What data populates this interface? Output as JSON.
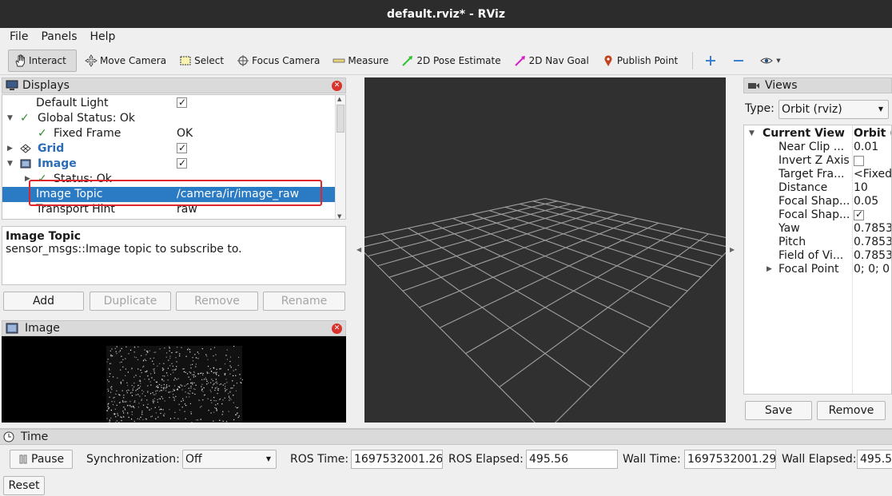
{
  "window": {
    "title": "default.rviz* - RViz"
  },
  "menu": [
    "File",
    "Panels",
    "Help"
  ],
  "toolbar": {
    "tools": [
      {
        "label": "Interact",
        "icon": "hand-icon",
        "active": true
      },
      {
        "label": "Move Camera",
        "icon": "move-camera-icon"
      },
      {
        "label": "Select",
        "icon": "select-icon"
      },
      {
        "label": "Focus Camera",
        "icon": "focus-camera-icon"
      },
      {
        "label": "Measure",
        "icon": "ruler-icon"
      },
      {
        "label": "2D Pose Estimate",
        "icon": "green-arrow-icon"
      },
      {
        "label": "2D Nav Goal",
        "icon": "pink-arrow-icon"
      },
      {
        "label": "Publish Point",
        "icon": "map-pin-icon"
      }
    ],
    "extra_icons": [
      "plus-icon",
      "minus-icon",
      "eye-icon"
    ]
  },
  "displays": {
    "title": "Displays",
    "rows": [
      {
        "name": "Default Light",
        "value": "",
        "checked": true
      },
      {
        "name": "Global Status: Ok",
        "value": ""
      },
      {
        "name": "Fixed Frame",
        "value": "OK"
      },
      {
        "name": "Grid",
        "value": "",
        "checked": true
      },
      {
        "name": "Image",
        "value": "",
        "checked": true
      },
      {
        "name": "Status: Ok",
        "value": ""
      },
      {
        "name": "Image Topic",
        "value": "/camera/ir/image_raw",
        "selected": true
      },
      {
        "name": "Transport Hint",
        "value": "raw"
      }
    ],
    "description_title": "Image Topic",
    "description_text": "sensor_msgs::Image topic to subscribe to.",
    "buttons": {
      "add": "Add",
      "duplicate": "Duplicate",
      "remove": "Remove",
      "rename": "Rename"
    }
  },
  "image_panel": {
    "title": "Image"
  },
  "views": {
    "title": "Views",
    "type_label": "Type:",
    "type_value": "Orbit (rviz)",
    "header_name": "Current View",
    "header_value": "Orbit (",
    "rows": [
      {
        "name": "Near Clip ...",
        "value": "0.01"
      },
      {
        "name": "Invert Z Axis",
        "value": "",
        "checkbox": false
      },
      {
        "name": "Target Fra...",
        "value": "<Fixed"
      },
      {
        "name": "Distance",
        "value": "10"
      },
      {
        "name": "Focal Shap...",
        "value": "0.05"
      },
      {
        "name": "Focal Shap...",
        "value": "",
        "checkbox": true
      },
      {
        "name": "Yaw",
        "value": "0.7853"
      },
      {
        "name": "Pitch",
        "value": "0.7853"
      },
      {
        "name": "Field of Vi...",
        "value": "0.7853"
      },
      {
        "name": "Focal Point",
        "value": "0; 0; 0"
      }
    ],
    "save": "Save",
    "remove": "Remove"
  },
  "time": {
    "title": "Time",
    "pause": "Pause",
    "sync_label": "Synchronization:",
    "sync_value": "Off",
    "ros_time_label": "ROS Time:",
    "ros_time": "1697532001.26",
    "ros_elapsed_label": "ROS Elapsed:",
    "ros_elapsed": "495.56",
    "wall_time_label": "Wall Time:",
    "wall_time": "1697532001.29",
    "wall_elapsed_label": "Wall Elapsed:",
    "wall_elapsed": "495.5",
    "reset": "Reset"
  }
}
